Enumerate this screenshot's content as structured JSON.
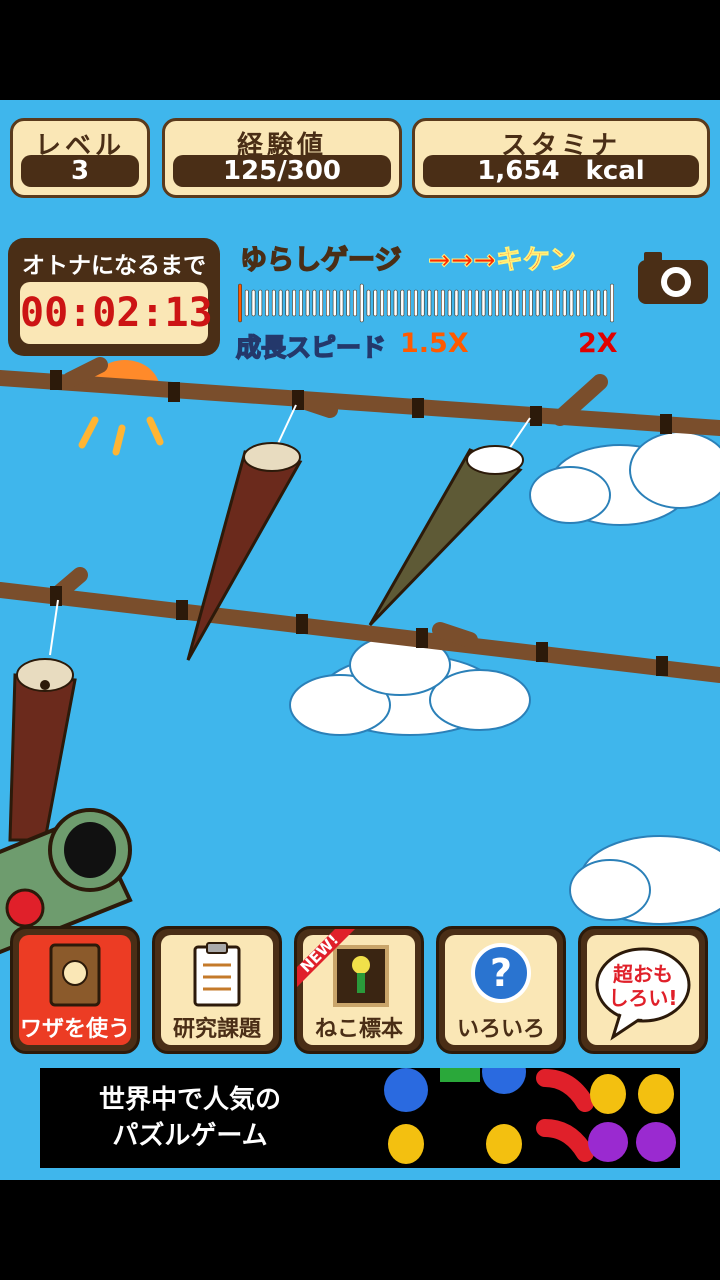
{
  "stats": {
    "level": {
      "label": "レベル",
      "value": "3"
    },
    "exp": {
      "label": "経験値",
      "value": "125/300"
    },
    "stamina": {
      "label": "スタミナ",
      "value": "1,654　kcal"
    }
  },
  "timer": {
    "label": "オトナになるまで",
    "value": "00:02:13"
  },
  "sway_gauge": {
    "label": "ゆらしゲージ",
    "danger_label": "→→→キケン",
    "fill_fraction": 0.02
  },
  "growth": {
    "label": "成長スピード",
    "min": "1.5X",
    "max": "2X"
  },
  "menu": [
    {
      "label": "ワザを使う",
      "icon": "technique-book-icon"
    },
    {
      "label": "研究課題",
      "icon": "clipboard-icon"
    },
    {
      "label": "ねこ標本",
      "icon": "cat-specimen-frame-icon",
      "badge": "NEW!"
    },
    {
      "label": "いろいろ",
      "icon": "question-mark-icon"
    },
    {
      "label": "超おも\nしろい!",
      "icon": "speech-bubble-icon"
    }
  ],
  "ad": {
    "text": "世界中で人気の\nパズルゲーム"
  },
  "colors": {
    "sky": "#3fb6ec",
    "panel": "#fae7b6",
    "wood": "#4a2e16",
    "danger": "#ff2a00"
  }
}
